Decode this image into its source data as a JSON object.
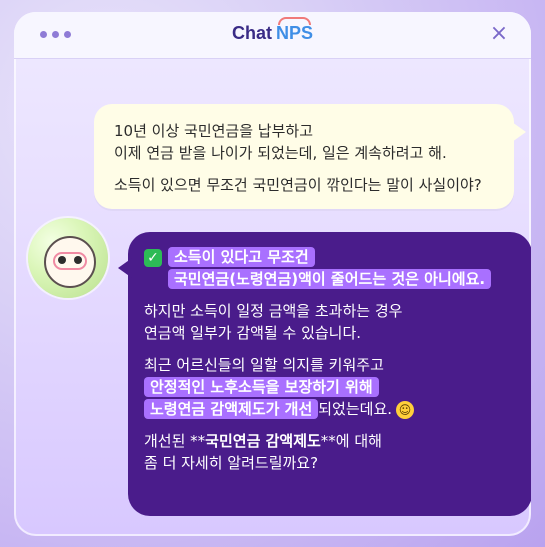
{
  "header": {
    "dots_count": 3,
    "logo_chat": "Chat",
    "logo_nps": "NPS",
    "close_symbol": "×"
  },
  "user_message": {
    "line1": "10년 이상 국민연금을 납부하고",
    "line2": "이제 연금 받을 나이가 되었는데, 일은 계속하려고 해.",
    "line3": "소득이 있으면 무조건 국민연금이 깎인다는 말이 사실이야?"
  },
  "bot_message": {
    "check_text": "✓",
    "highlight1_line1": "소득이 있다고 무조건",
    "highlight1_line2": "국민연금(노령연금)액이 줄어드는 것은 아니에요.",
    "para2_line1": "하지만 소득이 일정 금액을 초과하는 경우",
    "para2_line2": "연금액 일부가 감액될 수 있습니다.",
    "para3_line1": "최근 어르신들의 일할 의지를 키워주고",
    "para3_highlight1": "안정적인 노후소득을 보장하기 위해",
    "para3_highlight2": "노령연금 감액제도가 개선",
    "para3_tail": "되었는데요.",
    "smile_emoji": "☺",
    "para4_prefix": "개선된 **",
    "para4_bold": "국민연금 감액제도",
    "para4_suffix": "**에 대해",
    "para4_line2": "좀 더 자세히 알려드릴까요?"
  },
  "colors": {
    "header_bg": "#f7f6ff",
    "bot_bubble": "#4a1c8b",
    "highlight": "#a970ff",
    "user_bubble": "#fffde7",
    "accent": "#3f8ee6"
  }
}
